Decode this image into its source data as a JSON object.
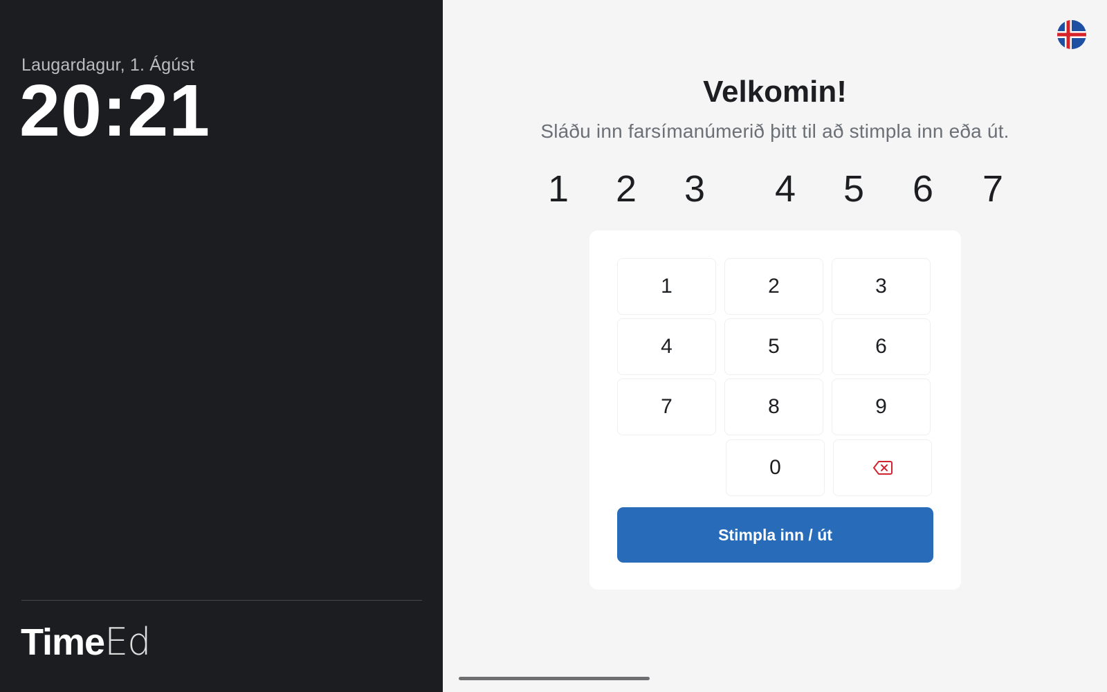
{
  "sidebar": {
    "date": "Laugardagur, 1. Ágúst",
    "time": "20:21",
    "logo_bold": "Time",
    "logo_light": "Ed"
  },
  "header": {
    "language_flag": "iceland-flag-icon"
  },
  "main": {
    "title": "Velkomin!",
    "subtitle": "Sláðu inn farsímanúmerið þitt til að stimpla inn eða út.",
    "entered_digits": [
      "1",
      "2",
      "3",
      "4",
      "5",
      "6",
      "7"
    ]
  },
  "keypad": {
    "keys": [
      "1",
      "2",
      "3",
      "4",
      "5",
      "6",
      "7",
      "8",
      "9",
      "0"
    ],
    "backspace_icon": "backspace-icon",
    "submit_label": "Stimpla inn / út"
  },
  "colors": {
    "sidebar_bg": "#1b1d21",
    "accent": "#286bb8",
    "backspace": "#d1242f"
  }
}
